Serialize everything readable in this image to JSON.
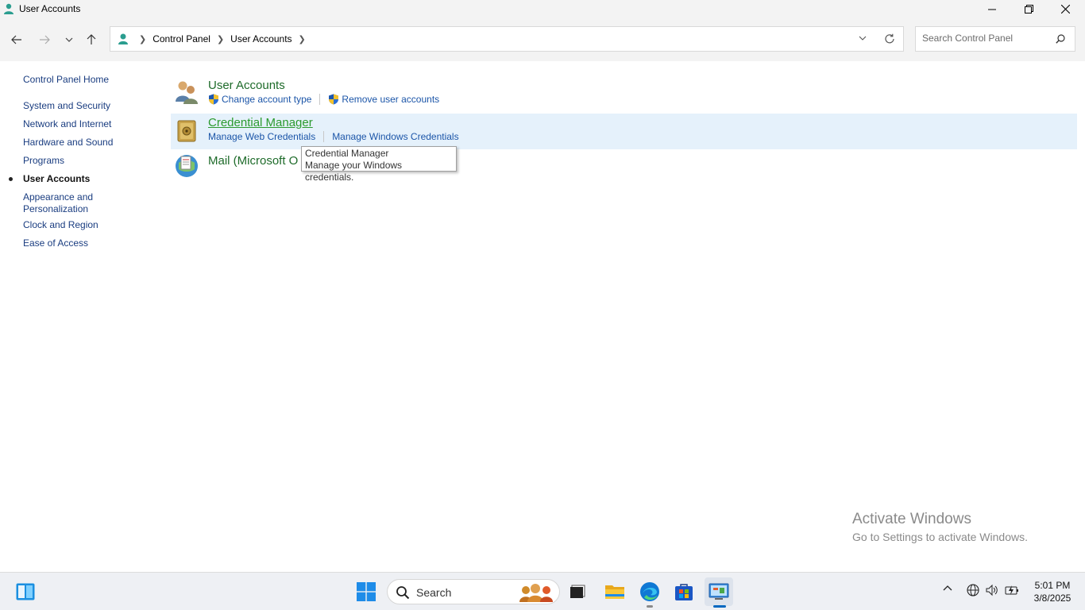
{
  "window": {
    "title": "User Accounts"
  },
  "address": {
    "crumbs": [
      "Control Panel",
      "User Accounts"
    ]
  },
  "search": {
    "placeholder": "Search Control Panel"
  },
  "sidebar": {
    "home": "Control Panel Home",
    "items": [
      {
        "label": "System and Security"
      },
      {
        "label": "Network and Internet"
      },
      {
        "label": "Hardware and Sound"
      },
      {
        "label": "Programs"
      },
      {
        "label": "User Accounts",
        "active": true
      },
      {
        "label": "Appearance and Personalization"
      },
      {
        "label": "Clock and Region"
      },
      {
        "label": "Ease of Access"
      }
    ]
  },
  "main": {
    "sections": [
      {
        "title": "User Accounts",
        "icon": "users-icon",
        "links": [
          "Change account type",
          "Remove user accounts"
        ]
      },
      {
        "title": "Credential Manager",
        "icon": "vault-icon",
        "links": [
          "Manage Web Credentials",
          "Manage Windows Credentials"
        ]
      },
      {
        "title": "Mail (Microsoft Outlook)",
        "visible_title": "Mail (Microsoft O",
        "icon": "mail-icon"
      }
    ]
  },
  "tooltip": {
    "title": "Credential Manager",
    "text": "Manage your Windows credentials."
  },
  "watermark": {
    "line1": "Activate Windows",
    "line2": "Go to Settings to activate Windows."
  },
  "taskbar": {
    "search_placeholder": "Search",
    "time": "5:01 PM",
    "date": "3/8/2025"
  },
  "colors": {
    "link": "#1b55a8",
    "title_green": "#1e6b2a",
    "highlight": "#e5f1fb",
    "accent": "#0067c0"
  }
}
